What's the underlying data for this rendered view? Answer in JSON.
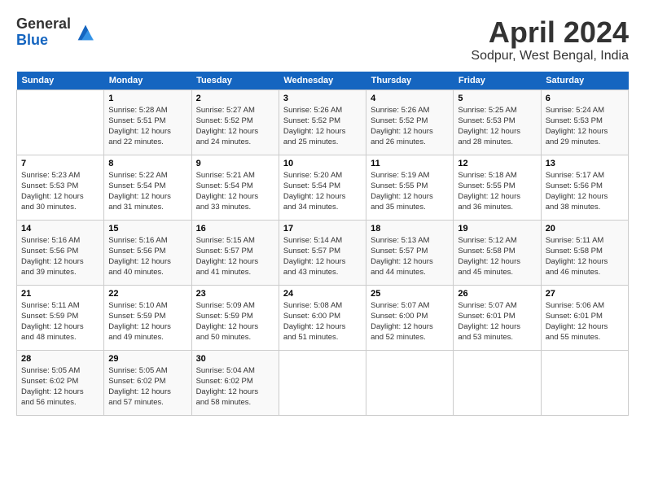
{
  "header": {
    "logo_general": "General",
    "logo_blue": "Blue",
    "month_title": "April 2024",
    "location": "Sodpur, West Bengal, India"
  },
  "days_of_week": [
    "Sunday",
    "Monday",
    "Tuesday",
    "Wednesday",
    "Thursday",
    "Friday",
    "Saturday"
  ],
  "weeks": [
    [
      {
        "day": "",
        "info": ""
      },
      {
        "day": "1",
        "info": "Sunrise: 5:28 AM\nSunset: 5:51 PM\nDaylight: 12 hours\nand 22 minutes."
      },
      {
        "day": "2",
        "info": "Sunrise: 5:27 AM\nSunset: 5:52 PM\nDaylight: 12 hours\nand 24 minutes."
      },
      {
        "day": "3",
        "info": "Sunrise: 5:26 AM\nSunset: 5:52 PM\nDaylight: 12 hours\nand 25 minutes."
      },
      {
        "day": "4",
        "info": "Sunrise: 5:26 AM\nSunset: 5:52 PM\nDaylight: 12 hours\nand 26 minutes."
      },
      {
        "day": "5",
        "info": "Sunrise: 5:25 AM\nSunset: 5:53 PM\nDaylight: 12 hours\nand 28 minutes."
      },
      {
        "day": "6",
        "info": "Sunrise: 5:24 AM\nSunset: 5:53 PM\nDaylight: 12 hours\nand 29 minutes."
      }
    ],
    [
      {
        "day": "7",
        "info": "Sunrise: 5:23 AM\nSunset: 5:53 PM\nDaylight: 12 hours\nand 30 minutes."
      },
      {
        "day": "8",
        "info": "Sunrise: 5:22 AM\nSunset: 5:54 PM\nDaylight: 12 hours\nand 31 minutes."
      },
      {
        "day": "9",
        "info": "Sunrise: 5:21 AM\nSunset: 5:54 PM\nDaylight: 12 hours\nand 33 minutes."
      },
      {
        "day": "10",
        "info": "Sunrise: 5:20 AM\nSunset: 5:54 PM\nDaylight: 12 hours\nand 34 minutes."
      },
      {
        "day": "11",
        "info": "Sunrise: 5:19 AM\nSunset: 5:55 PM\nDaylight: 12 hours\nand 35 minutes."
      },
      {
        "day": "12",
        "info": "Sunrise: 5:18 AM\nSunset: 5:55 PM\nDaylight: 12 hours\nand 36 minutes."
      },
      {
        "day": "13",
        "info": "Sunrise: 5:17 AM\nSunset: 5:56 PM\nDaylight: 12 hours\nand 38 minutes."
      }
    ],
    [
      {
        "day": "14",
        "info": "Sunrise: 5:16 AM\nSunset: 5:56 PM\nDaylight: 12 hours\nand 39 minutes."
      },
      {
        "day": "15",
        "info": "Sunrise: 5:16 AM\nSunset: 5:56 PM\nDaylight: 12 hours\nand 40 minutes."
      },
      {
        "day": "16",
        "info": "Sunrise: 5:15 AM\nSunset: 5:57 PM\nDaylight: 12 hours\nand 41 minutes."
      },
      {
        "day": "17",
        "info": "Sunrise: 5:14 AM\nSunset: 5:57 PM\nDaylight: 12 hours\nand 43 minutes."
      },
      {
        "day": "18",
        "info": "Sunrise: 5:13 AM\nSunset: 5:57 PM\nDaylight: 12 hours\nand 44 minutes."
      },
      {
        "day": "19",
        "info": "Sunrise: 5:12 AM\nSunset: 5:58 PM\nDaylight: 12 hours\nand 45 minutes."
      },
      {
        "day": "20",
        "info": "Sunrise: 5:11 AM\nSunset: 5:58 PM\nDaylight: 12 hours\nand 46 minutes."
      }
    ],
    [
      {
        "day": "21",
        "info": "Sunrise: 5:11 AM\nSunset: 5:59 PM\nDaylight: 12 hours\nand 48 minutes."
      },
      {
        "day": "22",
        "info": "Sunrise: 5:10 AM\nSunset: 5:59 PM\nDaylight: 12 hours\nand 49 minutes."
      },
      {
        "day": "23",
        "info": "Sunrise: 5:09 AM\nSunset: 5:59 PM\nDaylight: 12 hours\nand 50 minutes."
      },
      {
        "day": "24",
        "info": "Sunrise: 5:08 AM\nSunset: 6:00 PM\nDaylight: 12 hours\nand 51 minutes."
      },
      {
        "day": "25",
        "info": "Sunrise: 5:07 AM\nSunset: 6:00 PM\nDaylight: 12 hours\nand 52 minutes."
      },
      {
        "day": "26",
        "info": "Sunrise: 5:07 AM\nSunset: 6:01 PM\nDaylight: 12 hours\nand 53 minutes."
      },
      {
        "day": "27",
        "info": "Sunrise: 5:06 AM\nSunset: 6:01 PM\nDaylight: 12 hours\nand 55 minutes."
      }
    ],
    [
      {
        "day": "28",
        "info": "Sunrise: 5:05 AM\nSunset: 6:02 PM\nDaylight: 12 hours\nand 56 minutes."
      },
      {
        "day": "29",
        "info": "Sunrise: 5:05 AM\nSunset: 6:02 PM\nDaylight: 12 hours\nand 57 minutes."
      },
      {
        "day": "30",
        "info": "Sunrise: 5:04 AM\nSunset: 6:02 PM\nDaylight: 12 hours\nand 58 minutes."
      },
      {
        "day": "",
        "info": ""
      },
      {
        "day": "",
        "info": ""
      },
      {
        "day": "",
        "info": ""
      },
      {
        "day": "",
        "info": ""
      }
    ]
  ]
}
